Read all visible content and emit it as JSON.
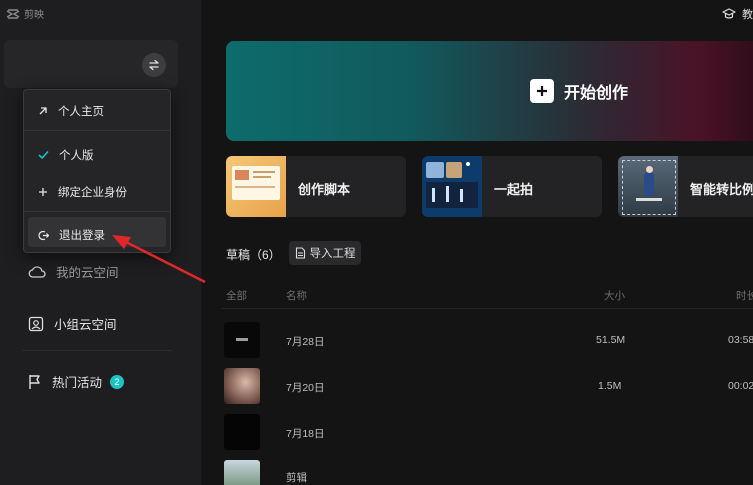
{
  "app": {
    "logo_text": "剪映"
  },
  "header": {
    "right_label": "教"
  },
  "dropdown": {
    "items": [
      {
        "label": "个人主页"
      },
      {
        "label": "个人版"
      },
      {
        "label": "绑定企业身份"
      },
      {
        "label": "退出登录"
      }
    ]
  },
  "sidebar": {
    "cloud_label": "我的云空间",
    "team_label": "小组云空间",
    "activity_label": "热门活动",
    "activity_badge": "2"
  },
  "banner": {
    "label": "开始创作"
  },
  "cards": [
    {
      "label": "创作脚本"
    },
    {
      "label": "一起拍"
    },
    {
      "label": "智能转比例"
    }
  ],
  "drafts": {
    "title": "草稿（6）",
    "import_label": "导入工程",
    "columns": {
      "all": "全部",
      "name": "名称",
      "size": "大小",
      "time": "时长"
    },
    "rows": [
      {
        "name": "7月28日",
        "size": "51.5M",
        "time": "03:58"
      },
      {
        "name": "7月20日",
        "size": "1.5M",
        "time": "00:02"
      },
      {
        "name": "7月18日",
        "size": "",
        "time": ""
      },
      {
        "name": "剪辑",
        "size": "",
        "time": ""
      }
    ]
  },
  "colors": {
    "accent": "#1cc4c4",
    "annotation_arrow": "#e0282a"
  }
}
